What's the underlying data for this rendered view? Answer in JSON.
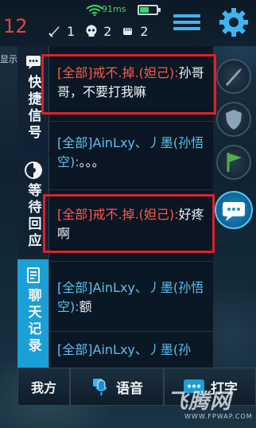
{
  "status": {
    "level": "12",
    "ping": "91ms",
    "battery_fraction": 0.55,
    "kills": "1",
    "deaths": "2",
    "assists": "2"
  },
  "left_strip": {
    "text": "显示"
  },
  "side_tabs": [
    {
      "label": "快捷信号",
      "icon": "quick-signal-icon",
      "active": false
    },
    {
      "label": "等待回应",
      "icon": "wait-response-icon",
      "active": false
    },
    {
      "label": "聊天记录",
      "icon": "chat-log-icon",
      "active": true
    }
  ],
  "messages": [
    {
      "channel": "[全部]",
      "name": "戒不.掉.(妲己):",
      "text": "孙哥哥，不要打我嘛",
      "highlight": true
    },
    {
      "channel": "[全部]",
      "name": "AinLxy、丿墨(孙悟空):",
      "text": "。。。",
      "highlight": false
    },
    {
      "channel": "[全部]",
      "name": "戒不.掉.(妲己):",
      "text": "好疼啊",
      "highlight": true
    },
    {
      "channel": "[全部]",
      "name": "AinLxy、丿墨(孙悟空):",
      "text": "额",
      "highlight": false
    },
    {
      "channel": "[全部]",
      "name": "AinLxy、丿墨(孙",
      "text": "",
      "highlight": false
    }
  ],
  "bottom_bar": {
    "self_label": "我方",
    "voice_label": "语音",
    "type_label": "打字"
  },
  "watermark": {
    "logo": "飞腾网",
    "url": "WWW.FPWAP.COM"
  },
  "colors": {
    "accent": "#1aa0d6",
    "highlight_name": "#ff5a4a",
    "channel_blue": "#58c2f0",
    "level_red": "#e8453a",
    "ping_green": "#3ed66a",
    "box_red": "#e0202a"
  }
}
